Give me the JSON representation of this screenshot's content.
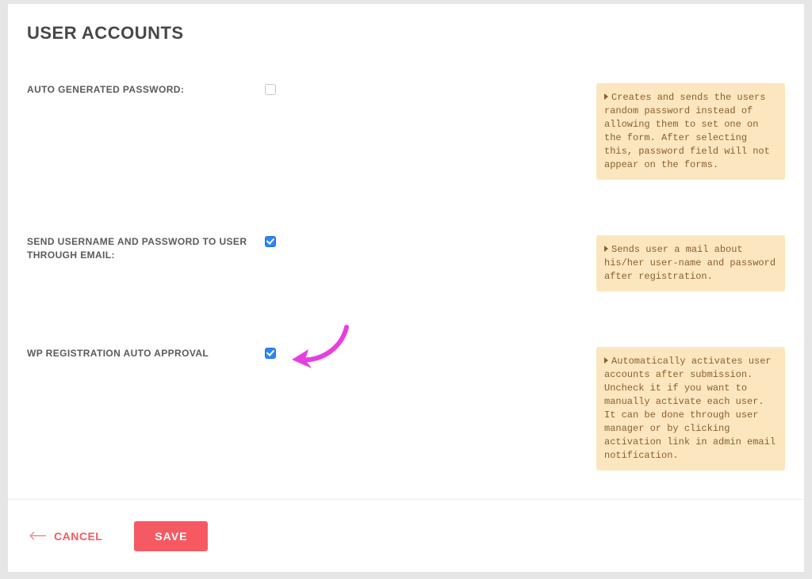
{
  "page": {
    "title": "USER ACCOUNTS"
  },
  "settings": {
    "auto_pw": {
      "label": "AUTO GENERATED PASSWORD:",
      "checked": false,
      "info": "Creates and sends the users random password instead of allowing them to set one on the form. After selecting this, password field will not appear on the forms."
    },
    "send_email": {
      "label": "SEND USERNAME AND PASSWORD TO USER THROUGH EMAIL:",
      "checked": true,
      "info": "Sends user a mail about his/her user-name and password after registration."
    },
    "auto_approval": {
      "label": "WP REGISTRATION AUTO APPROVAL",
      "checked": true,
      "info": "Automatically activates user accounts after submission. Uncheck it if you want to manually activate each user. It can be done through user manager or by clicking activation link in admin email notification."
    }
  },
  "footer": {
    "cancel_label": "CANCEL",
    "save_label": "SAVE"
  },
  "colors": {
    "accent": "#f55a63",
    "checkbox": "#2f86f2",
    "infobox_bg": "#fce6bf",
    "infobox_text": "#8b5f2d",
    "annotation": "#e83ee0"
  }
}
